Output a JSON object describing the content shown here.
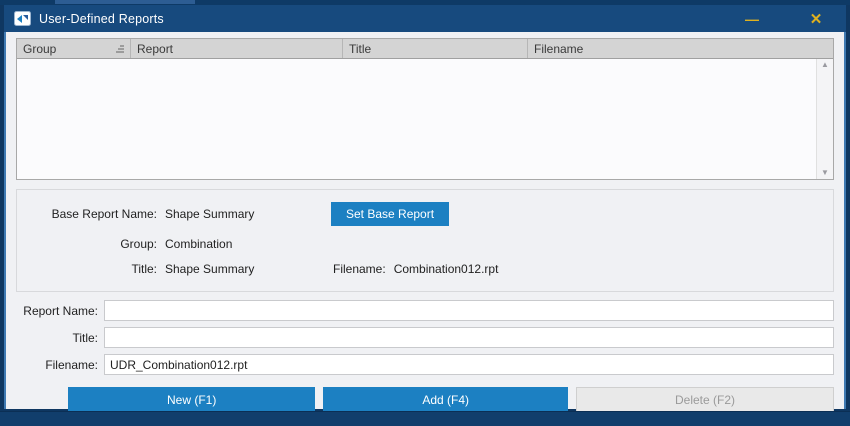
{
  "window": {
    "title": "User-Defined Reports",
    "minimize_glyph": "—",
    "close_glyph": "✕"
  },
  "table": {
    "columns": [
      "Group",
      "Report",
      "Title",
      "Filename"
    ],
    "rows": [],
    "sorted_column": "Group"
  },
  "base_report": {
    "name_label": "Base Report Name:",
    "name_value": "Shape Summary",
    "set_button_label": "Set Base Report",
    "group_label": "Group:",
    "group_value": "Combination",
    "title_label": "Title:",
    "title_value": "Shape Summary",
    "filename_label": "Filename:",
    "filename_value": "Combination012.rpt"
  },
  "form": {
    "report_name_label": "Report Name:",
    "report_name_value": "",
    "title_label": "Title:",
    "title_value": "",
    "filename_label": "Filename:",
    "filename_value": "UDR_Combination012.rpt"
  },
  "actions": {
    "new_label": "New (F1)",
    "add_label": "Add (F4)",
    "delete_label": "Delete (F2)"
  },
  "colors": {
    "titlebar": "#174a7e",
    "frame": "#0f3761",
    "accent_button": "#1c80c2",
    "titlebar_glyphs": "#dfb11f",
    "table_header": "#d4d4d4",
    "body_background": "#f0f1f4"
  }
}
